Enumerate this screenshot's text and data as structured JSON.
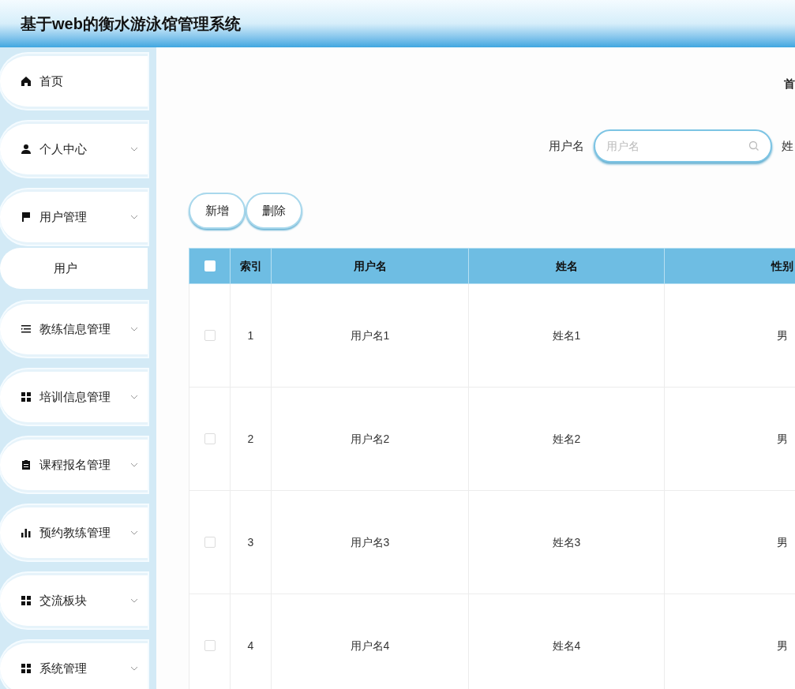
{
  "header": {
    "title": "基于web的衡水游泳馆管理系统"
  },
  "sidebar": {
    "items": [
      {
        "label": "首页",
        "kind": "home",
        "expandable": false
      },
      {
        "label": "个人中心",
        "kind": "user",
        "expandable": true
      },
      {
        "label": "用户管理",
        "kind": "flag",
        "expandable": true,
        "children": [
          {
            "label": "用户"
          }
        ]
      },
      {
        "label": "教练信息管理",
        "kind": "list",
        "expandable": true
      },
      {
        "label": "培训信息管理",
        "kind": "grid",
        "expandable": true
      },
      {
        "label": "课程报名管理",
        "kind": "clipboard",
        "expandable": true
      },
      {
        "label": "预约教练管理",
        "kind": "bars",
        "expandable": true
      },
      {
        "label": "交流板块",
        "kind": "grid",
        "expandable": true
      },
      {
        "label": "系统管理",
        "kind": "grid",
        "expandable": true
      }
    ]
  },
  "breadcrumb": "首",
  "search": {
    "label": "用户名",
    "placeholder": "用户名",
    "next_label": "姓"
  },
  "buttons": [
    "新增",
    "删除"
  ],
  "table": {
    "all_selected": false,
    "columns": [
      "索引",
      "用户名",
      "姓名",
      "性别"
    ],
    "rows": [
      {
        "selected": false,
        "cells": [
          "1",
          "用户名1",
          "姓名1",
          "男"
        ]
      },
      {
        "selected": false,
        "cells": [
          "2",
          "用户名2",
          "姓名2",
          "男"
        ]
      },
      {
        "selected": false,
        "cells": [
          "3",
          "用户名3",
          "姓名3",
          "男"
        ]
      },
      {
        "selected": false,
        "cells": [
          "4",
          "用户名4",
          "姓名4",
          "男"
        ]
      }
    ]
  }
}
